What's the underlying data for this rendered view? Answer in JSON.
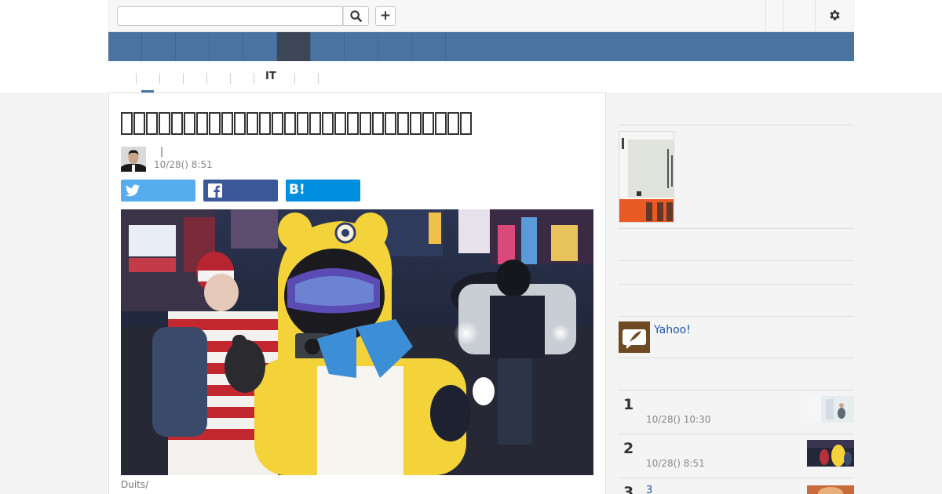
{
  "header": {
    "search": {
      "value": "",
      "placeholder": ""
    },
    "search_icon": "search-icon",
    "add_label": "+",
    "settings_icon": "gear-icon"
  },
  "nav": {
    "tabs": [
      "",
      "",
      "",
      "",
      "",
      "",
      "",
      "",
      "",
      ""
    ],
    "active_index": 5
  },
  "sub_nav": {
    "active_label": "IT",
    "underline_color": "#4a73a0"
  },
  "article": {
    "headline_glyph_count": 28,
    "byline_separator": "|",
    "timestamp": "10/28() 8:51",
    "share": {
      "twitter_icon": "twitter-icon",
      "facebook_icon": "facebook-icon",
      "hatena_label": "B!"
    },
    "photo_credit": "Duits/"
  },
  "sidebar": {
    "yahoo_label": "Yahoo!",
    "ranking": [
      {
        "rank": "1",
        "time": "10/28() 10:30"
      },
      {
        "rank": "2",
        "time": "10/28() 8:51"
      },
      {
        "rank": "3",
        "title": "3"
      }
    ]
  },
  "colors": {
    "nav_blue": "#4a73a0",
    "nav_active": "#3d4656",
    "twitter": "#55acee",
    "facebook": "#3b5998",
    "hatena": "#008fde",
    "link": "#1c57a5"
  }
}
